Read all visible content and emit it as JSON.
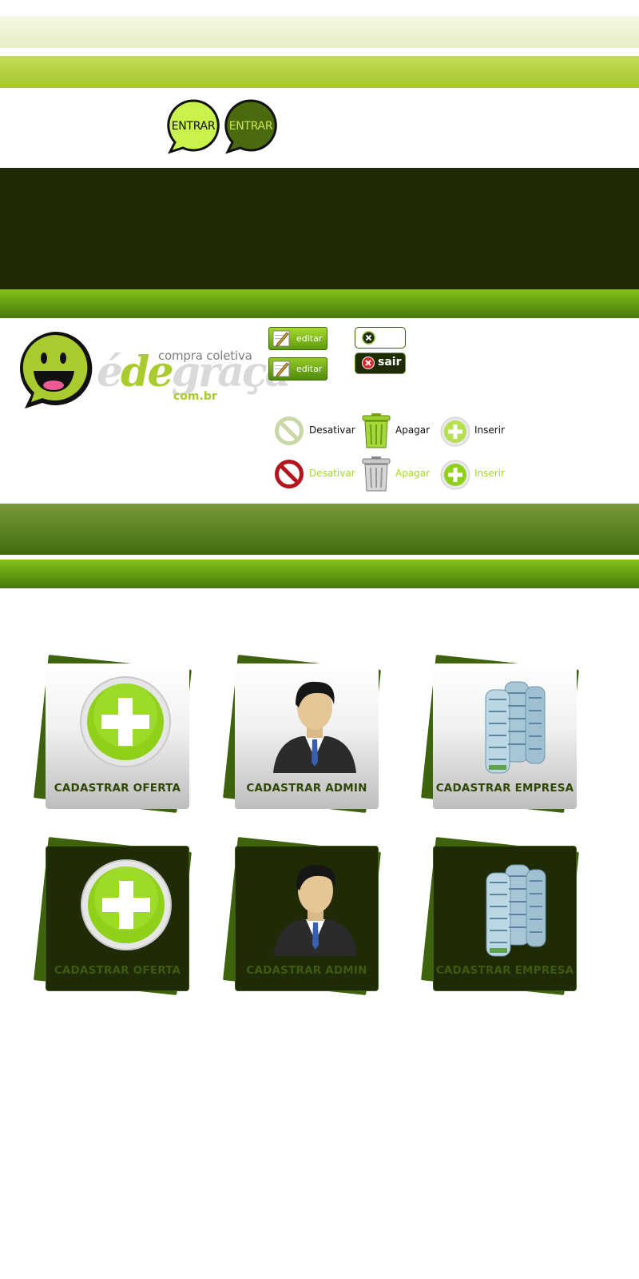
{
  "login_buttons": {
    "primary_label": "ENTRAR",
    "hover_label": "ENTRAR"
  },
  "logo": {
    "tagline": "compra coletiva",
    "word_e": "é",
    "word_de": "de",
    "word_graca": "graça",
    "domain": "com.br"
  },
  "edit_buttons": {
    "label_1": "editar",
    "label_2": "editar"
  },
  "logout_buttons": {
    "solid_label": "sair"
  },
  "actions": {
    "normal": {
      "disable": "Desativar",
      "delete": "Apagar",
      "insert": "Inserir"
    },
    "hover": {
      "disable": "Desativar",
      "delete": "Apagar",
      "insert": "Inserir"
    }
  },
  "cards": {
    "light": [
      "CADASTRAR OFERTA",
      "CADASTRAR ADMIN",
      "CADASTRAR EMPRESA"
    ],
    "dark": [
      "CADASTRAR OFERTA",
      "CADASTRAR ADMIN",
      "CADASTRAR EMPRESA"
    ]
  },
  "colors": {
    "dark_green": "#1f2a07",
    "lime": "#a9cb2d",
    "mid_green": "#46780c",
    "accent_text": "#a8d827"
  }
}
